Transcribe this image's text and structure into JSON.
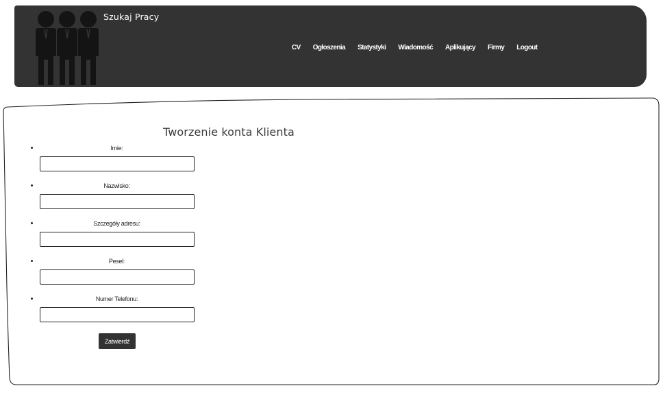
{
  "header": {
    "site_title": "Szukaj Pracy",
    "logo_icon": "people-group-icon",
    "background_color": "#333333",
    "nav": [
      {
        "label": "CV"
      },
      {
        "label": "Ogłoszenia"
      },
      {
        "label": "Statystyki"
      },
      {
        "label": "Wiadomość"
      },
      {
        "label": "Aplikujący"
      },
      {
        "label": "Firmy"
      },
      {
        "label": "Logout"
      }
    ]
  },
  "form": {
    "title": "Tworzenie konta Klienta",
    "fields": [
      {
        "label": "Imie:",
        "value": ""
      },
      {
        "label": "Nazwisko:",
        "value": ""
      },
      {
        "label": "Szczegóły adresu:",
        "value": ""
      },
      {
        "label": "Pesel:",
        "value": ""
      },
      {
        "label": "Numer Telefonu:",
        "value": ""
      }
    ],
    "submit_label": "Zatwierdź"
  }
}
